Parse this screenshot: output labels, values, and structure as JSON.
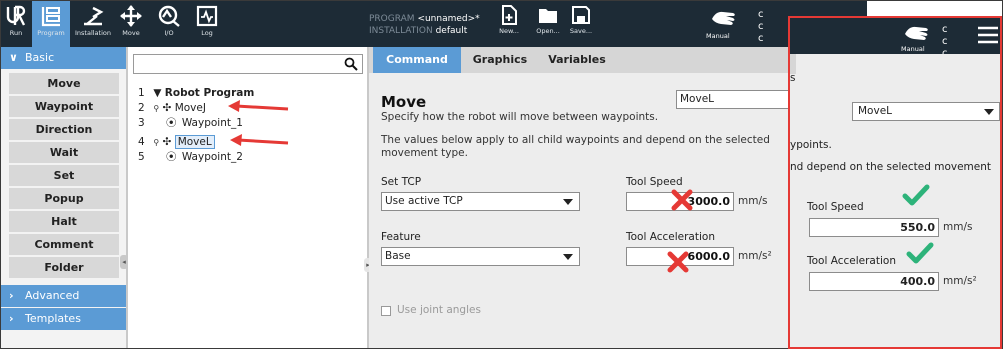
{
  "toolbar": {
    "run_label": "Run",
    "program_label": "Program",
    "installation_label": "Installation",
    "move_label": "Move",
    "io_label": "I/O",
    "log_label": "Log",
    "program_key": "PROGRAM",
    "program_value": "<unnamed>*",
    "installation_key": "INSTALLATION",
    "installation_value": "default",
    "new_label": "New...",
    "open_label": "Open...",
    "save_label": "Save...",
    "mode_label": "Manual",
    "accent_color": "#5b9bd5"
  },
  "nav": {
    "basic_label": "Basic",
    "items": [
      "Move",
      "Waypoint",
      "Direction",
      "Wait",
      "Set",
      "Popup",
      "Halt",
      "Comment",
      "Folder"
    ],
    "advanced_label": "Advanced",
    "templates_label": "Templates"
  },
  "tree": {
    "search_placeholder": "",
    "rows": [
      {
        "num": "1",
        "text": "Robot Program"
      },
      {
        "num": "2",
        "text": "MoveJ"
      },
      {
        "num": "3",
        "text": "Waypoint_1"
      },
      {
        "num": "4",
        "text": "MoveL"
      },
      {
        "num": "5",
        "text": "Waypoint_2"
      }
    ]
  },
  "command": {
    "tabs": [
      "Command",
      "Graphics",
      "Variables"
    ],
    "title": "Move",
    "subtitle": "Specify how the robot will move between waypoints.",
    "move_type": "MoveL",
    "description": "The values below apply to all child waypoints and depend on the selected movement type.",
    "set_tcp_label": "Set TCP",
    "set_tcp_value": "Use active TCP",
    "feature_label": "Feature",
    "feature_value": "Base",
    "tool_speed_label": "Tool Speed",
    "tool_speed_value": "3000.0",
    "tool_speed_unit": "mm/s",
    "tool_accel_label": "Tool Acceleration",
    "tool_accel_value": "6000.0",
    "tool_accel_unit": "mm/s²",
    "joint_angles_label": "Use joint angles"
  },
  "overlay": {
    "mode_label": "Manual",
    "edge_text_s": "s",
    "move_type": "MoveL",
    "edge_text_1": "ypoints.",
    "edge_text_2": "nd depend on the selected movement",
    "tool_speed_label": "Tool Speed",
    "tool_speed_value": "550.0",
    "tool_speed_unit": "mm/s",
    "tool_accel_label": "Tool Acceleration",
    "tool_accel_value": "400.0",
    "tool_accel_unit": "mm/s²",
    "border_color": "#e53935",
    "check_color": "#2db37a"
  }
}
